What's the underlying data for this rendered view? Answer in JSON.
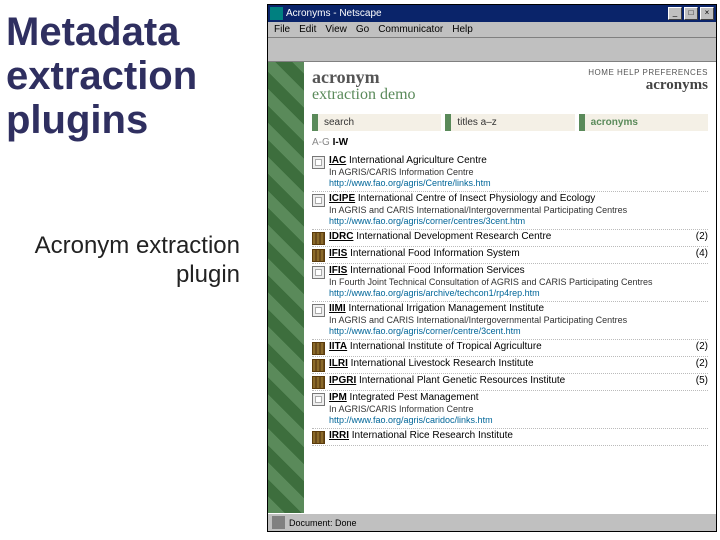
{
  "slide": {
    "title": "Metadata extraction plugins",
    "subtitle": "Acronym extraction plugin"
  },
  "window": {
    "title": "Acronyms - Netscape",
    "minimize": "_",
    "maximize": "□",
    "close": "×",
    "menu": [
      "File",
      "Edit",
      "View",
      "Go",
      "Communicator",
      "Help"
    ],
    "status": "Document: Done"
  },
  "page": {
    "brand1": "acronym",
    "brand2": "extraction demo",
    "toplinks": "HOME  HELP  PREFERENCES",
    "righttitle": "acronyms",
    "nav": {
      "search": "search",
      "titles": "titles a–z",
      "acronyms": "acronyms"
    },
    "alpha": {
      "range1": "A-G",
      "range2": "I-W"
    }
  },
  "results": [
    {
      "type": "doc",
      "acr": "IAC",
      "name": "International Agriculture Centre",
      "sub": "In AGRIS/CARIS Information Centre",
      "url": "http://www.fao.org/agris/Centre/links.htm",
      "count": ""
    },
    {
      "type": "doc",
      "acr": "ICIPE",
      "name": "International Centre of Insect Physiology and Ecology",
      "sub": "In AGRIS and CARIS International/Intergovernmental Participating Centres",
      "url": "http://www.fao.org/agris/corner/centres/3cent.htm",
      "count": ""
    },
    {
      "type": "shelf",
      "acr": "IDRC",
      "name": "International Development Research Centre",
      "sub": "",
      "url": "",
      "count": "(2)"
    },
    {
      "type": "shelf",
      "acr": "IFIS",
      "name": "International Food Information System",
      "sub": "",
      "url": "",
      "count": "(4)"
    },
    {
      "type": "doc",
      "acr": "IFIS",
      "name": "International Food Information Services",
      "sub": "In Fourth Joint Technical Consultation of AGRIS and CARIS Participating Centres",
      "url": "http://www.fao.org/agris/archive/techcon1/rp4rep.htm",
      "count": ""
    },
    {
      "type": "doc",
      "acr": "IIMI",
      "name": "International Irrigation Management Institute",
      "sub": "In AGRIS and CARIS International/Intergovernmental Participating Centres",
      "url": "http://www.fao.org/agris/corner/centre/3cent.htm",
      "count": ""
    },
    {
      "type": "shelf",
      "acr": "IITA",
      "name": "International Institute of Tropical Agriculture",
      "sub": "",
      "url": "",
      "count": "(2)"
    },
    {
      "type": "shelf",
      "acr": "ILRI",
      "name": "International Livestock Research Institute",
      "sub": "",
      "url": "",
      "count": "(2)"
    },
    {
      "type": "shelf",
      "acr": "IPGRI",
      "name": "International Plant Genetic Resources Institute",
      "sub": "",
      "url": "",
      "count": "(5)"
    },
    {
      "type": "doc",
      "acr": "IPM",
      "name": "Integrated Pest Management",
      "sub": "In AGRIS/CARIS Information Centre",
      "url": "http://www.fao.org/agris/caridoc/links.htm",
      "count": ""
    },
    {
      "type": "shelf",
      "acr": "IRRI",
      "name": "International Rice Research Institute",
      "sub": "",
      "url": "",
      "count": ""
    }
  ]
}
